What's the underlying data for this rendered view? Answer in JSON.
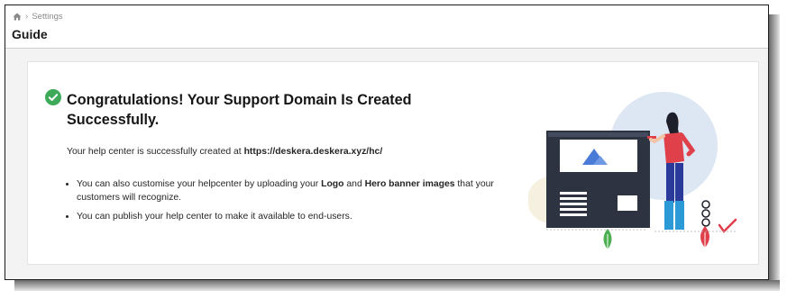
{
  "breadcrumb": {
    "home_icon": "home-icon",
    "separator": "›",
    "current": "Settings"
  },
  "header": {
    "title": "Guide"
  },
  "card": {
    "headline_line1": "Congratulations! Your Support Domain Is Created",
    "headline_line2": "Successfully.",
    "intro_prefix": "Your help center is successfully created at ",
    "intro_url": "https://deskera.deskera.xyz/hc/",
    "bullet1_prefix": "You can also customise your helpcenter by uploading your ",
    "bullet1_logo": "Logo",
    "bullet1_and": " and ",
    "bullet1_hero": "Hero banner images",
    "bullet1_suffix": " that your customers will recognize.",
    "bullet2": "You can publish your help center to make it available to end-users."
  },
  "colors": {
    "success_green": "#3fa95a",
    "illustration_blue": "#4a7bd6",
    "accent_red": "#e0404a"
  }
}
